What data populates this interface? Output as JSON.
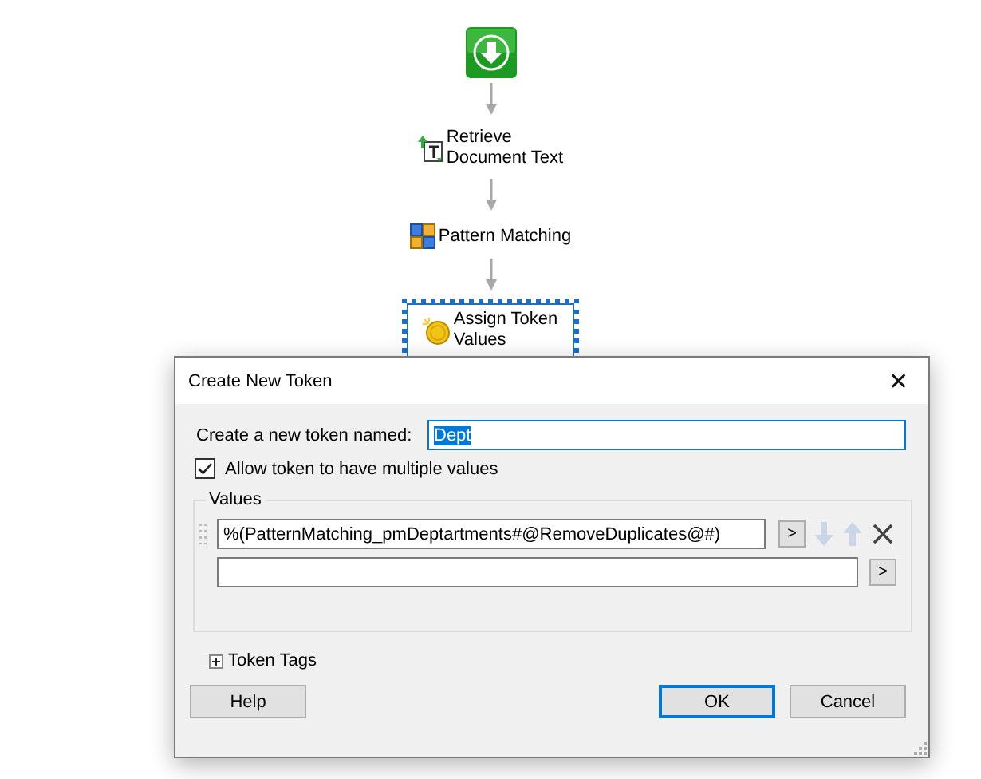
{
  "workflow": {
    "nodes": [
      {
        "kind": "start",
        "selected": false
      },
      {
        "kind": "retrieve",
        "label": "Retrieve\nDocument Text",
        "selected": false
      },
      {
        "kind": "pattern",
        "label": "Pattern Matching",
        "selected": false
      },
      {
        "kind": "assign",
        "label": "Assign Token\nValues",
        "selected": true
      }
    ]
  },
  "dialog": {
    "title": "Create New Token",
    "close": "✕",
    "name_field": {
      "label": "Create a new token named:",
      "value": "Dept",
      "highlighted": true
    },
    "multiple_values": {
      "label": "Allow token to have multiple values",
      "checked": true
    },
    "values_group": {
      "title": "Values",
      "rows": [
        {
          "kind": "filled",
          "value": "%(PatternMatching_pmDeptartments#@RemoveDuplicates@#)",
          "insert_label": ">",
          "move_enabled": false
        },
        {
          "kind": "empty",
          "insert_label": ">"
        }
      ]
    },
    "token_tags": {
      "label": "Token Tags",
      "expanded": false
    },
    "buttons": [
      {
        "label": "Help",
        "default": false
      },
      {
        "label": "OK",
        "default": true
      },
      {
        "label": "Cancel",
        "default": false
      }
    ]
  }
}
